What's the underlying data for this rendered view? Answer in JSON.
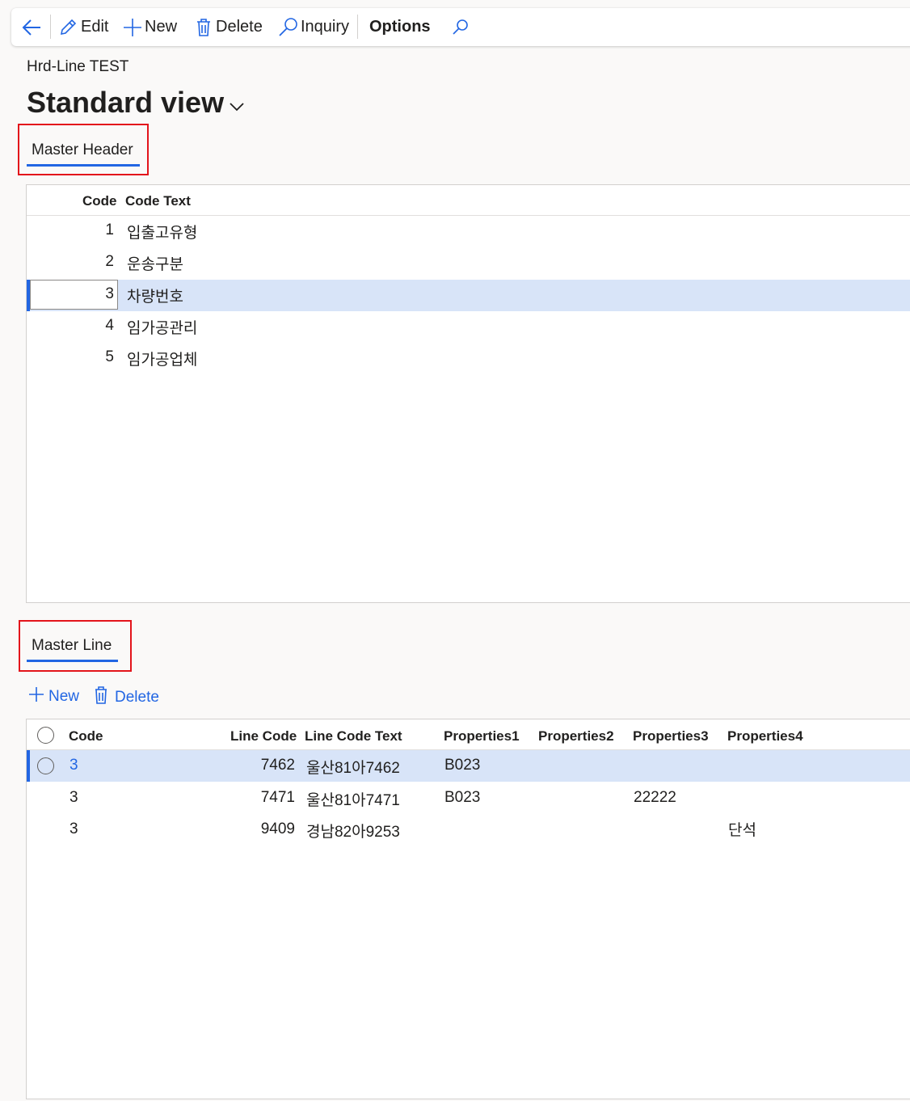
{
  "toolbar": {
    "back_icon": "arrow-left-icon",
    "edit_label": "Edit",
    "new_label": "New",
    "delete_label": "Delete",
    "inquiry_label": "Inquiry",
    "options_label": "Options",
    "search_icon": "search-icon"
  },
  "page": {
    "caption": "Hrd-Line TEST",
    "view_title": "Standard view"
  },
  "master_header": {
    "tab_label": "Master Header",
    "columns": [
      "Code",
      "Code Text"
    ],
    "rows": [
      {
        "code": "1",
        "text": "입출고유형"
      },
      {
        "code": "2",
        "text": "운송구분"
      },
      {
        "code": "3",
        "text": "차량번호"
      },
      {
        "code": "4",
        "text": "임가공관리"
      },
      {
        "code": "5",
        "text": "임가공업체"
      }
    ],
    "selected_row": 3
  },
  "master_line": {
    "tab_label": "Master Line",
    "new_label": "New",
    "delete_label": "Delete",
    "columns": [
      "Code",
      "Line Code",
      "Line Code Text",
      "Properties1",
      "Properties2",
      "Properties3",
      "Properties4"
    ],
    "rows": [
      {
        "code": "3",
        "line_code": "7462",
        "line_code_text": "울산81아7462",
        "p1": "B023",
        "p2": "",
        "p3": "",
        "p4": ""
      },
      {
        "code": "3",
        "line_code": "7471",
        "line_code_text": "울산81아7471",
        "p1": "B023",
        "p2": "",
        "p3": "22222",
        "p4": ""
      },
      {
        "code": "3",
        "line_code": "9409",
        "line_code_text": "경남82아9253",
        "p1": "",
        "p2": "",
        "p3": "",
        "p4": "단석"
      }
    ],
    "selected_row": 1
  },
  "colors": {
    "accent": "#2266e3",
    "selection": "#d8e4f8",
    "highlight_box": "#e3141b"
  }
}
